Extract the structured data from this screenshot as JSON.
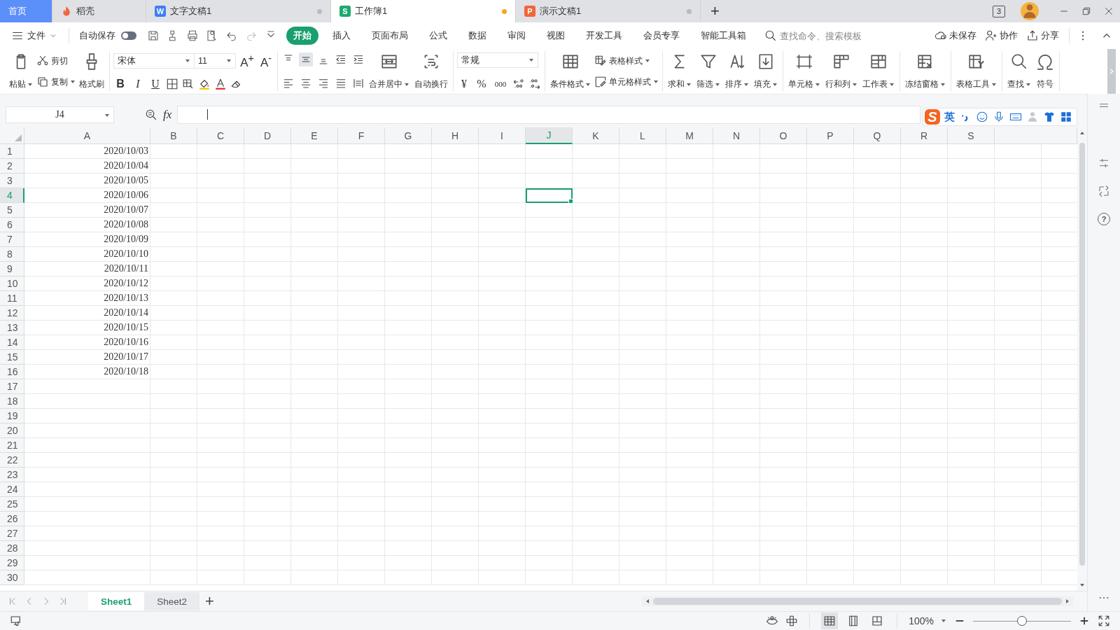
{
  "tabs": [
    {
      "kind": "home",
      "label": "首页",
      "selected": false
    },
    {
      "kind": "daoke",
      "label": "稻壳",
      "selected": false
    },
    {
      "kind": "writer",
      "icon_letter": "W",
      "label": "文字文稿1",
      "selected": false,
      "modified": false
    },
    {
      "kind": "sheet",
      "icon_letter": "S",
      "label": "工作簿1",
      "selected": true,
      "modified": true
    },
    {
      "kind": "presentation",
      "icon_letter": "P",
      "label": "演示文稿1",
      "selected": false,
      "modified": false
    }
  ],
  "new_tab": "+",
  "window": {
    "tab_count": "3"
  },
  "menu": {
    "file": "文件",
    "autosave": {
      "label": "自动保存",
      "on": false
    },
    "ribbon_tabs": [
      {
        "label": "开始",
        "selected": true
      },
      {
        "label": "插入",
        "selected": false
      },
      {
        "label": "页面布局",
        "selected": false
      },
      {
        "label": "公式",
        "selected": false
      },
      {
        "label": "数据",
        "selected": false
      },
      {
        "label": "审阅",
        "selected": false
      },
      {
        "label": "视图",
        "selected": false
      },
      {
        "label": "开发工具",
        "selected": false
      },
      {
        "label": "会员专享",
        "selected": false
      },
      {
        "label": "智能工具箱",
        "selected": false
      }
    ],
    "search": {
      "placeholder": "查找命令、搜索模板"
    },
    "actions": [
      {
        "label": "未保存"
      },
      {
        "label": "协作"
      },
      {
        "label": "分享"
      }
    ]
  },
  "ribbon": {
    "clipboard": {
      "paste": "粘贴",
      "cut": "剪切",
      "copy": "复制",
      "format_painter": "格式刷"
    },
    "font": {
      "name": "宋体",
      "size": "11",
      "grow": "A$^{+}$",
      "shrink": "A$^{-}$",
      "bold": "B",
      "italic": "I",
      "underline": "U"
    },
    "alignment": {
      "vertical": [
        {
          "selected": false
        },
        {
          "selected": true
        },
        {
          "selected": false
        }
      ],
      "merge": "合并居中",
      "wrap": "自动换行"
    },
    "number": {
      "format": "常规",
      "currency": "¥",
      "percent": "%",
      "thousands": "000"
    },
    "styles": {
      "conditional": "条件格式",
      "table_style": "表格样式",
      "cell_style": "单元格样式"
    },
    "tool_groups": [
      [
        {
          "label": "求和",
          "dropdown": true
        },
        {
          "label": "筛选",
          "dropdown": true
        },
        {
          "label": "排序",
          "dropdown": true
        },
        {
          "label": "填充",
          "dropdown": true
        }
      ],
      [
        {
          "label": "单元格",
          "dropdown": true
        },
        {
          "label": "行和列",
          "dropdown": true
        },
        {
          "label": "工作表",
          "dropdown": true
        }
      ],
      [
        {
          "label": "冻结窗格",
          "dropdown": true
        }
      ],
      [
        {
          "label": "表格工具",
          "dropdown": true
        }
      ],
      [
        {
          "label": "查找",
          "dropdown": true
        },
        {
          "label": "符号",
          "dropdown": false
        }
      ]
    ]
  },
  "formula_bar": {
    "name_box": "J4",
    "fx": "fx"
  },
  "grid": {
    "columns": [
      {
        "label": "A",
        "selected": false
      },
      {
        "label": "B",
        "selected": false
      },
      {
        "label": "C",
        "selected": false
      },
      {
        "label": "D",
        "selected": false
      },
      {
        "label": "E",
        "selected": false
      },
      {
        "label": "F",
        "selected": false
      },
      {
        "label": "G",
        "selected": false
      },
      {
        "label": "H",
        "selected": false
      },
      {
        "label": "I",
        "selected": false
      },
      {
        "label": "J",
        "selected": true
      },
      {
        "label": "K",
        "selected": false
      },
      {
        "label": "L",
        "selected": false
      },
      {
        "label": "M",
        "selected": false
      },
      {
        "label": "N",
        "selected": false
      },
      {
        "label": "O",
        "selected": false
      },
      {
        "label": "P",
        "selected": false
      },
      {
        "label": "Q",
        "selected": false
      },
      {
        "label": "R",
        "selected": false
      },
      {
        "label": "S",
        "selected": false
      }
    ],
    "rows": [
      {
        "label": "1",
        "selected": false,
        "cells": [
          "2020/10/03"
        ]
      },
      {
        "label": "2",
        "selected": false,
        "cells": [
          "2020/10/04"
        ]
      },
      {
        "label": "3",
        "selected": false,
        "cells": [
          "2020/10/05"
        ]
      },
      {
        "label": "4",
        "selected": true,
        "cells": [
          "2020/10/06"
        ]
      },
      {
        "label": "5",
        "selected": false,
        "cells": [
          "2020/10/07"
        ]
      },
      {
        "label": "6",
        "selected": false,
        "cells": [
          "2020/10/08"
        ]
      },
      {
        "label": "7",
        "selected": false,
        "cells": [
          "2020/10/09"
        ]
      },
      {
        "label": "8",
        "selected": false,
        "cells": [
          "2020/10/10"
        ]
      },
      {
        "label": "9",
        "selected": false,
        "cells": [
          "2020/10/11"
        ]
      },
      {
        "label": "10",
        "selected": false,
        "cells": [
          "2020/10/12"
        ]
      },
      {
        "label": "11",
        "selected": false,
        "cells": [
          "2020/10/13"
        ]
      },
      {
        "label": "12",
        "selected": false,
        "cells": [
          "2020/10/14"
        ]
      },
      {
        "label": "13",
        "selected": false,
        "cells": [
          "2020/10/15"
        ]
      },
      {
        "label": "14",
        "selected": false,
        "cells": [
          "2020/10/16"
        ]
      },
      {
        "label": "15",
        "selected": false,
        "cells": [
          "2020/10/17"
        ]
      },
      {
        "label": "16",
        "selected": false,
        "cells": [
          "2020/10/18"
        ]
      },
      {
        "label": "17",
        "selected": false
      },
      {
        "label": "18",
        "selected": false
      },
      {
        "label": "19",
        "selected": false
      },
      {
        "label": "20",
        "selected": false
      },
      {
        "label": "21",
        "selected": false
      },
      {
        "label": "22",
        "selected": false
      },
      {
        "label": "23",
        "selected": false
      },
      {
        "label": "24",
        "selected": false
      },
      {
        "label": "25",
        "selected": false
      },
      {
        "label": "26",
        "selected": false
      },
      {
        "label": "27",
        "selected": false
      },
      {
        "label": "28",
        "selected": false
      },
      {
        "label": "29",
        "selected": false
      },
      {
        "label": "30",
        "selected": false
      }
    ]
  },
  "sheets": [
    {
      "label": "Sheet1",
      "selected": true
    },
    {
      "label": "Sheet2",
      "selected": false
    }
  ],
  "add_sheet": "+",
  "ime": {
    "logo": "S",
    "mode": "英"
  },
  "sidebar": {
    "help": "?"
  },
  "status_bar": {
    "zoom": "100%",
    "zoom_slider": {
      "level": 0.5
    },
    "views": [
      {
        "selected": true
      },
      {
        "selected": false
      },
      {
        "selected": false
      }
    ]
  }
}
